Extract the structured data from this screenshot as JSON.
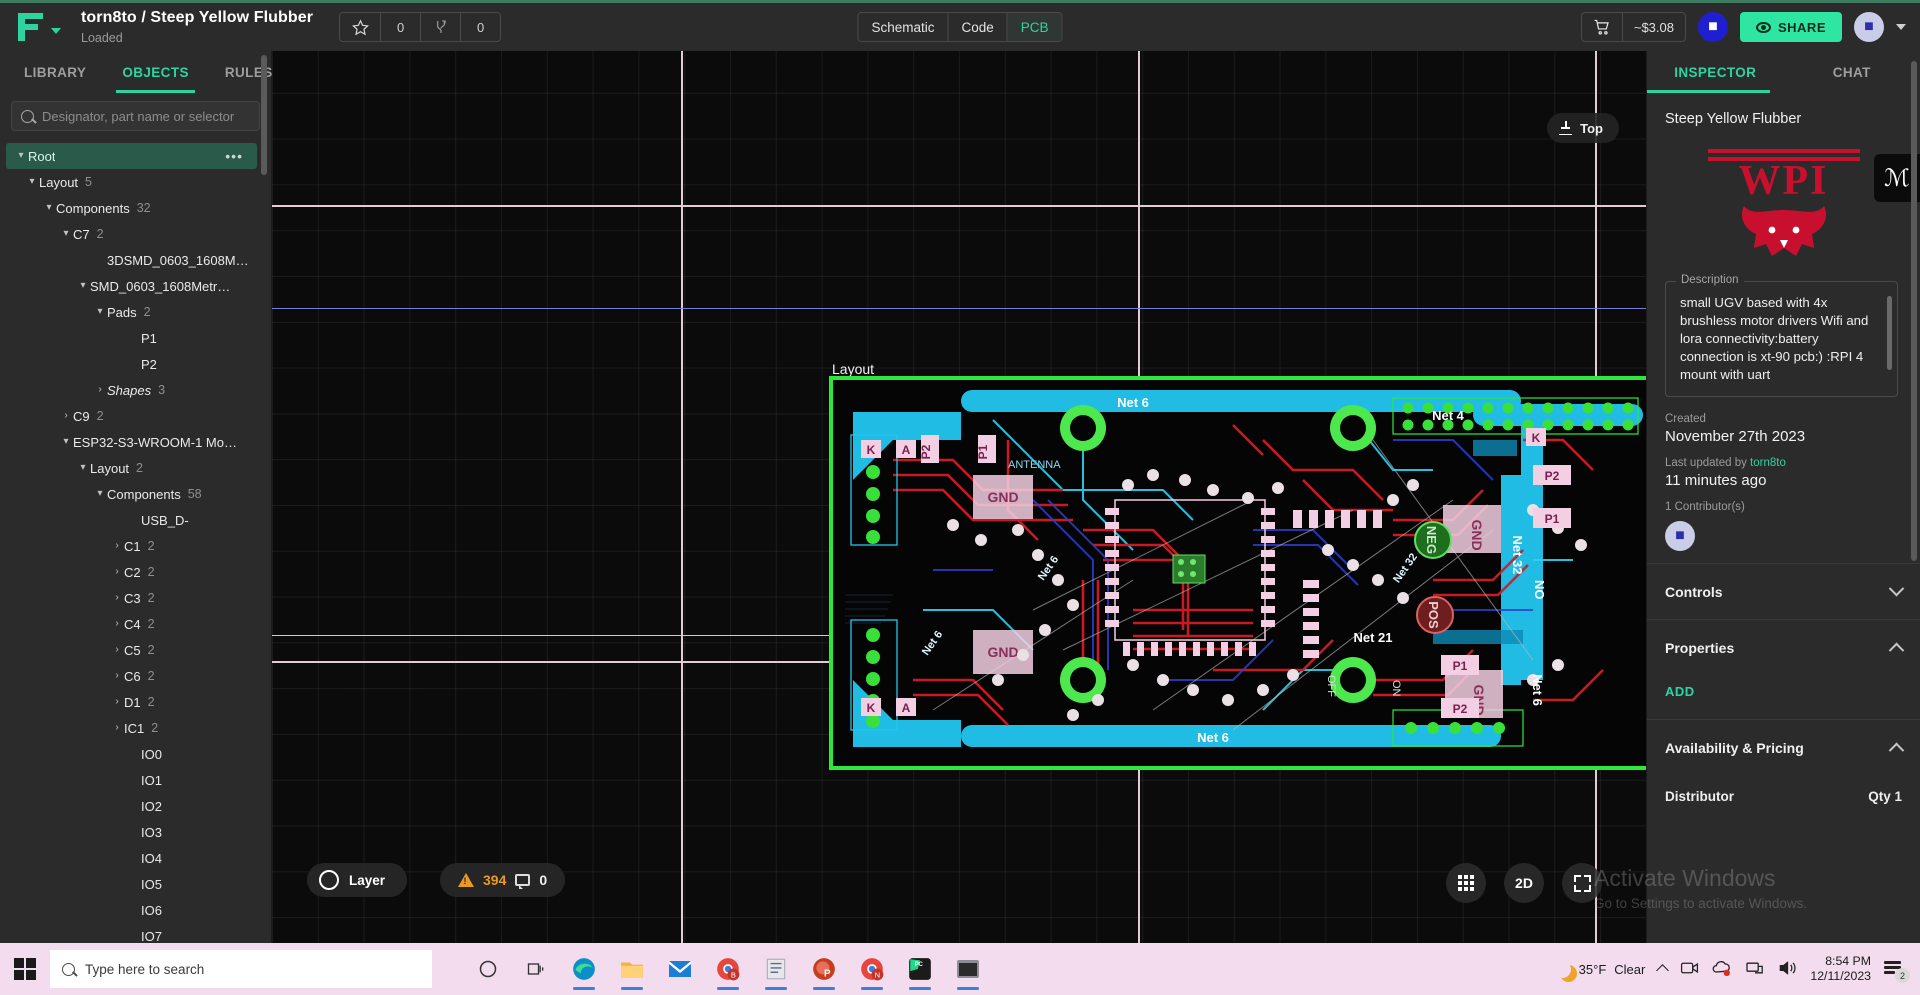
{
  "header": {
    "project_owner": "torn8to",
    "project_separator": " / ",
    "project_name": "Steep Yellow Flubber",
    "project_title": "torn8to / Steep Yellow Flubber",
    "status": "Loaded",
    "star_count": "0",
    "fork_count": "0",
    "modes": [
      {
        "label": "Schematic",
        "active": false
      },
      {
        "label": "Code",
        "active": false
      },
      {
        "label": "PCB",
        "active": true
      }
    ],
    "price": "~$3.08",
    "share_label": "SHARE",
    "accent_color": "#2dd4a0"
  },
  "left_panel": {
    "tabs": [
      {
        "label": "LIBRARY",
        "active": false
      },
      {
        "label": "OBJECTS",
        "active": true
      },
      {
        "label": "RULES",
        "active": false
      }
    ],
    "search_placeholder": "Designator, part name or selector",
    "search_value": "",
    "tree": [
      {
        "label": "Root",
        "count": "",
        "depth": 0,
        "chev": "down",
        "selected": true,
        "dots": "•••"
      },
      {
        "label": "Layout",
        "count": "5",
        "depth": 1,
        "chev": "down"
      },
      {
        "label": "Components",
        "count": "32",
        "depth": 2,
        "chev": "down"
      },
      {
        "label": "C7",
        "count": "2",
        "depth": 3,
        "chev": "down"
      },
      {
        "label": "3DSMD_0603_1608M…",
        "count": "",
        "depth": 5,
        "chev": "none"
      },
      {
        "label": "SMD_0603_1608Metr…",
        "count": "",
        "depth": 4,
        "chev": "down"
      },
      {
        "label": "Pads",
        "count": "2",
        "depth": 5,
        "chev": "down"
      },
      {
        "label": "P1",
        "count": "",
        "depth": 7,
        "chev": "none"
      },
      {
        "label": "P2",
        "count": "",
        "depth": 7,
        "chev": "none"
      },
      {
        "label": "Shapes",
        "count": "3",
        "depth": 5,
        "chev": "right",
        "italic": true
      },
      {
        "label": "C9",
        "count": "2",
        "depth": 3,
        "chev": "right"
      },
      {
        "label": "ESP32-S3-WROOM-1 Mo…",
        "count": "",
        "depth": 3,
        "chev": "down"
      },
      {
        "label": "Layout",
        "count": "2",
        "depth": 4,
        "chev": "down"
      },
      {
        "label": "Components",
        "count": "58",
        "depth": 5,
        "chev": "down"
      },
      {
        "label": "USB_D-",
        "count": "",
        "depth": 7,
        "chev": "none"
      },
      {
        "label": "C1",
        "count": "2",
        "depth": 6,
        "chev": "right"
      },
      {
        "label": "C2",
        "count": "2",
        "depth": 6,
        "chev": "right"
      },
      {
        "label": "C3",
        "count": "2",
        "depth": 6,
        "chev": "right"
      },
      {
        "label": "C4",
        "count": "2",
        "depth": 6,
        "chev": "right"
      },
      {
        "label": "C5",
        "count": "2",
        "depth": 6,
        "chev": "right"
      },
      {
        "label": "C6",
        "count": "2",
        "depth": 6,
        "chev": "right"
      },
      {
        "label": "D1",
        "count": "2",
        "depth": 6,
        "chev": "right"
      },
      {
        "label": "IC1",
        "count": "2",
        "depth": 6,
        "chev": "right"
      },
      {
        "label": "IO0",
        "count": "",
        "depth": 7,
        "chev": "none"
      },
      {
        "label": "IO1",
        "count": "",
        "depth": 7,
        "chev": "none"
      },
      {
        "label": "IO2",
        "count": "",
        "depth": 7,
        "chev": "none"
      },
      {
        "label": "IO3",
        "count": "",
        "depth": 7,
        "chev": "none"
      },
      {
        "label": "IO4",
        "count": "",
        "depth": 7,
        "chev": "none"
      },
      {
        "label": "IO5",
        "count": "",
        "depth": 7,
        "chev": "none"
      },
      {
        "label": "IO6",
        "count": "",
        "depth": 7,
        "chev": "none"
      },
      {
        "label": "IO7",
        "count": "",
        "depth": 7,
        "chev": "none"
      }
    ]
  },
  "canvas": {
    "view_button": "Top",
    "layout_label": "Layout",
    "layer_label": "Layer",
    "warning_count": "394",
    "comment_count": "0",
    "view_mode": "2D",
    "net_labels": [
      "Net 6",
      "Net 6",
      "Net 6",
      "Net 6",
      "Net 32",
      "Net 32",
      "Net 21",
      "Net 4",
      "ANTENNA",
      "GND",
      "GND",
      "GND",
      "GND",
      "NEG",
      "POS",
      "NO",
      "P1",
      "P2",
      "K",
      "A",
      "OFF",
      "ON"
    ]
  },
  "inspector": {
    "tabs": [
      {
        "label": "INSPECTOR",
        "active": true
      },
      {
        "label": "CHAT",
        "active": false
      }
    ],
    "title": "Steep Yellow Flubber",
    "logo_text": "WPI",
    "signature": "ℳ",
    "description_legend": "Description",
    "description": "small UGV based  with 4x brushless motor drivers Wifi and lora connectivity:battery connection is xt-90 pcb:) :RPI 4 mount with uart",
    "created_label": "Created",
    "created_value": "November 27th 2023",
    "updated_label_prefix": "Last updated by ",
    "updated_user": "torn8to",
    "updated_value": "11 minutes ago",
    "contributors_label": "1 Contributor(s)",
    "sections": [
      {
        "label": "Controls",
        "expanded": false
      },
      {
        "label": "Properties",
        "expanded": true
      },
      {
        "label": "Availability & Pricing",
        "expanded": true
      }
    ],
    "add_label": "ADD",
    "distributor_label": "Distributor",
    "qty_label": "Qty 1"
  },
  "watermark": {
    "line1": "Activate Windows",
    "line2": "Go to Settings to activate Windows."
  },
  "taskbar": {
    "search_placeholder": "Type here to search",
    "temperature": "35°F",
    "weather": "Clear",
    "time": "8:54 PM",
    "date": "12/11/2023",
    "notification_count": "2"
  }
}
